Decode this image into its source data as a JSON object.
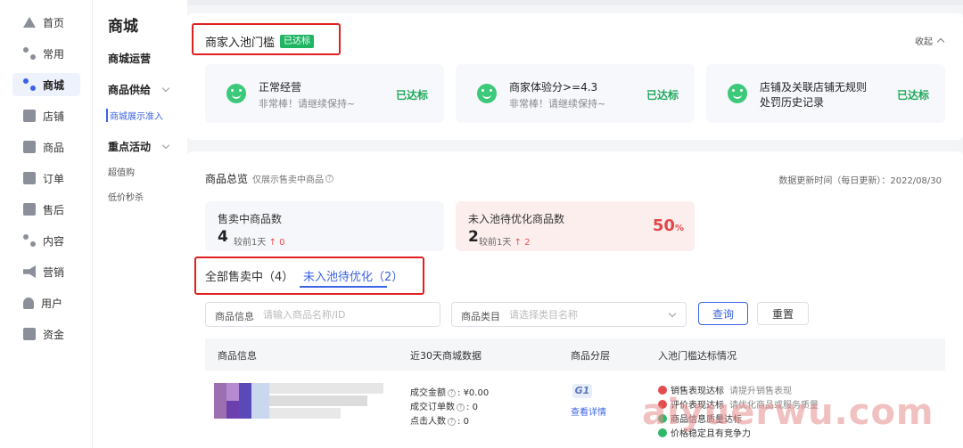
{
  "nav": {
    "items": [
      {
        "label": "首页",
        "icon": "home-icon"
      },
      {
        "label": "常用",
        "icon": "apps-icon"
      },
      {
        "label": "商城",
        "icon": "mall-icon",
        "active": true
      },
      {
        "label": "店铺",
        "icon": "shop-icon"
      },
      {
        "label": "商品",
        "icon": "goods-icon"
      },
      {
        "label": "订单",
        "icon": "order-icon"
      },
      {
        "label": "售后",
        "icon": "aftersale-icon"
      },
      {
        "label": "内容",
        "icon": "content-icon"
      },
      {
        "label": "营销",
        "icon": "megaphone-icon"
      },
      {
        "label": "用户",
        "icon": "user-icon"
      },
      {
        "label": "资金",
        "icon": "wallet-icon"
      }
    ]
  },
  "subnav": {
    "title": "商城",
    "mall_ops": "商城运营",
    "supply": "商品供给",
    "display_access": "商城展示准入",
    "key_events": "重点活动",
    "value_buy": "超值购",
    "flash_sale": "低价秒杀"
  },
  "threshold": {
    "title": "商家入池门槛",
    "badge": "已达标",
    "collapse": "收起",
    "criteria": [
      {
        "title": "正常经营",
        "desc": "非常棒！请继续保持~",
        "status": "已达标"
      },
      {
        "title": "商家体验分>=4.3",
        "desc": "非常棒！请继续保持~",
        "status": "已达标"
      },
      {
        "title": "店铺及关联店铺无规则",
        "title2": "处罚历史记录",
        "desc": "",
        "status": "已达标"
      }
    ]
  },
  "overview": {
    "title": "商品总览",
    "subtitle": "仅展示售卖中商品",
    "update_time": "数据更新时间（每日更新）：2022/08/30",
    "on_sale": {
      "label": "售卖中商品数",
      "value": "4",
      "cmp": "较前1天",
      "delta": "↑ 0"
    },
    "to_optimize": {
      "label": "未入池待优化商品数",
      "value": "2",
      "cmp": "较前1天",
      "delta": "↑ 2",
      "percent": "50",
      "percent_unit": "%"
    }
  },
  "tabs": {
    "all": "全部售卖中（4）",
    "pending": "未入池待优化（2）"
  },
  "filters": {
    "product_label": "商品信息",
    "product_placeholder": "请输入商品名称/ID",
    "category_label": "商品类目",
    "category_placeholder": "请选择类目名称",
    "query": "查询",
    "reset": "重置"
  },
  "table": {
    "headers": [
      "商品信息",
      "近30天商城数据",
      "商品分层",
      "入池门槛达标情况"
    ],
    "row": {
      "metrics": [
        {
          "label": "成交金额",
          "value": "¥0.00"
        },
        {
          "label": "成交订单数",
          "value": "0"
        },
        {
          "label": "点击人数",
          "value": "0"
        }
      ],
      "tier": "G1",
      "tier_link": "查看详情",
      "conditions": [
        {
          "status": "bad",
          "text": "销售表现达标",
          "hint": "请提升销售表现"
        },
        {
          "status": "bad",
          "text": "评价表现达标",
          "hint": "请优化商品或服务质量"
        },
        {
          "status": "good",
          "text": "商品信息质量达标",
          "hint": ""
        },
        {
          "status": "good",
          "text": "价格稳定且有竞争力",
          "hint": ""
        }
      ]
    }
  },
  "watermark": "aiyuerwu.com",
  "colors": {
    "accent": "#3b63e6",
    "success": "#20b562",
    "danger": "#e02020"
  }
}
